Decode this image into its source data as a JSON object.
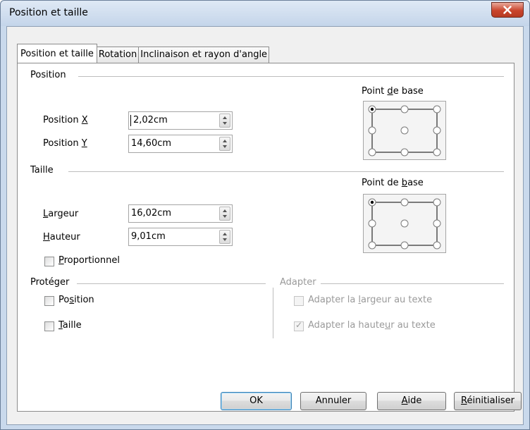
{
  "window": {
    "title": "Position et taille"
  },
  "tabs": [
    {
      "label": "Position et taille",
      "active": true
    },
    {
      "label": "Rotation",
      "active": false
    },
    {
      "label": "Inclinaison et rayon d'angle",
      "active": false
    }
  ],
  "position": {
    "heading": "Position",
    "x": {
      "label_pre": "Position ",
      "label_key": "X",
      "label_post": "",
      "value": "2,02cm"
    },
    "y": {
      "label_pre": "Position ",
      "label_key": "Y",
      "label_post": "",
      "value": "14,60cm"
    },
    "base_point": {
      "label_pre": "Point ",
      "label_key": "d",
      "label_post": "e base"
    }
  },
  "size": {
    "heading": "Taille",
    "width": {
      "label_pre": "",
      "label_key": "L",
      "label_post": "argeur",
      "value": "16,02cm"
    },
    "height": {
      "label_pre": "",
      "label_key": "H",
      "label_post": "auteur",
      "value": "9,01cm"
    },
    "proportional": {
      "label_pre": "",
      "label_key": "P",
      "label_post": "roportionnel",
      "checked": false
    },
    "base_point": {
      "label_pre": "Point de ",
      "label_key": "b",
      "label_post": "ase"
    }
  },
  "protect": {
    "heading": "Protéger",
    "position": {
      "label_pre": "Po",
      "label_key": "s",
      "label_post": "ition",
      "checked": false
    },
    "size": {
      "label_pre": "",
      "label_key": "T",
      "label_post": "aille",
      "checked": false
    }
  },
  "adapt": {
    "heading": "Adapter",
    "fit_width": {
      "label_pre": "Adapter la ",
      "label_key": "l",
      "label_post": "argeur au texte",
      "checked": false
    },
    "fit_height": {
      "label_pre": "Adapter la haute",
      "label_key": "u",
      "label_post": "r au texte",
      "checked": true
    }
  },
  "buttons": {
    "ok": "OK",
    "cancel": "Annuler",
    "help_key": "A",
    "help_rest": "ide",
    "reset_key": "R",
    "reset_rest": "éinitialiser"
  }
}
